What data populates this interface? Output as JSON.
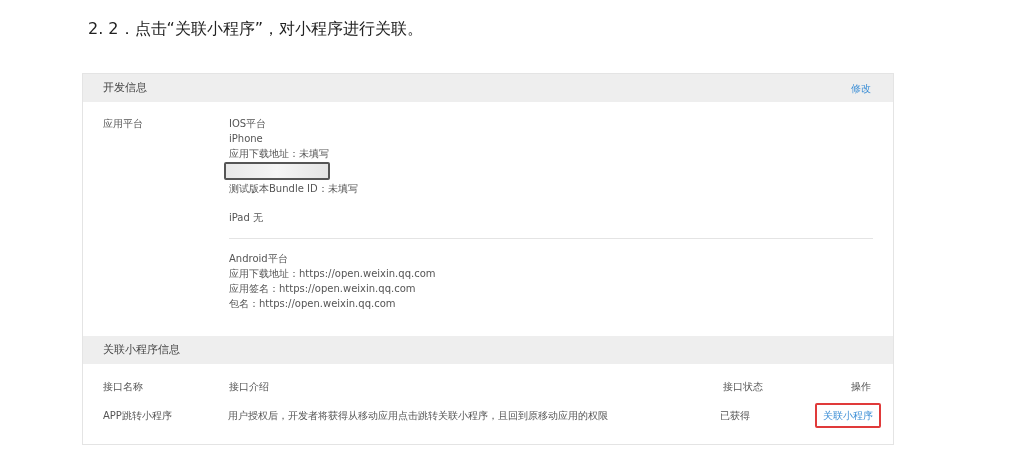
{
  "heading": "2. 2．点击“关联小程序”，对小程序进行关联。",
  "dev_info": {
    "title": "开发信息",
    "edit_link": "修改",
    "label": "应用平台",
    "ios": {
      "title": "IOS平台",
      "iphone": "iPhone",
      "download": "应用下载地址：未填写",
      "bundle": "测试版本Bundle ID：未填写",
      "ipad": "iPad 无"
    },
    "android": {
      "title": "Android平台",
      "lines": [
        "应用下载地址：https://open.weixin.qq.com",
        "应用签名：https://open.weixin.qq.com",
        "包名：https://open.weixin.qq.com"
      ]
    }
  },
  "mini_program": {
    "title": "关联小程序信息",
    "columns": [
      "接口名称",
      "接口介绍",
      "接口状态",
      "操作"
    ],
    "rows": [
      {
        "name": "APP跳转小程序",
        "description": "用户授权后，开发者将获得从移动应用点击跳转关联小程序，且回到原移动应用的权限",
        "status": "已获得",
        "action": "关联小程序",
        "highlighted": true
      }
    ]
  }
}
